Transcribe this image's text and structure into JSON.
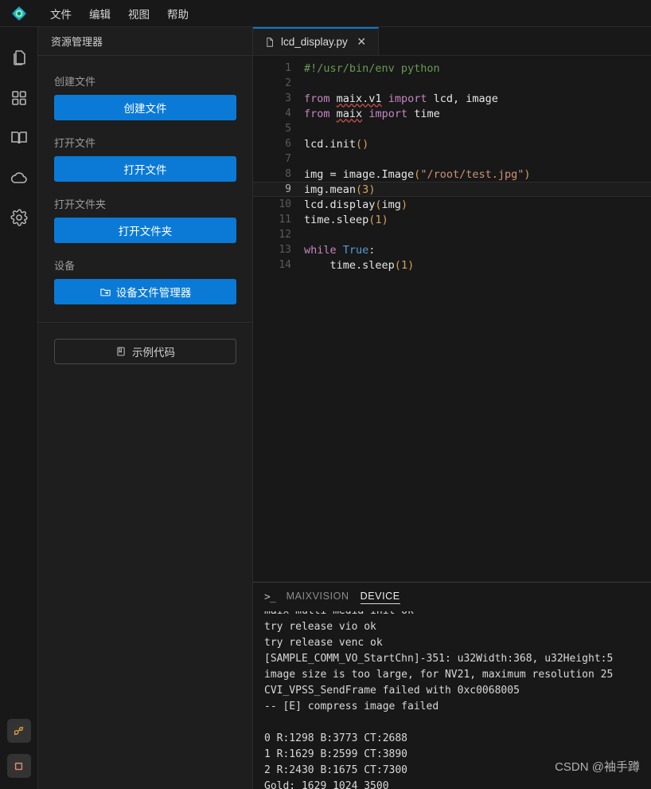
{
  "app": {
    "logo_icon": "maixvision-eye-logo",
    "menu": [
      {
        "label": "文件",
        "name": "menu-file"
      },
      {
        "label": "编辑",
        "name": "menu-edit"
      },
      {
        "label": "视图",
        "name": "menu-view"
      },
      {
        "label": "帮助",
        "name": "menu-help"
      }
    ]
  },
  "activitybar": {
    "items": [
      {
        "icon": "files-icon",
        "name": "activity-explorer"
      },
      {
        "icon": "grid-apps-icon",
        "name": "activity-apps"
      },
      {
        "icon": "book-icon",
        "name": "activity-docs"
      },
      {
        "icon": "cloud-icon",
        "name": "activity-cloud"
      },
      {
        "icon": "gear-icon",
        "name": "activity-settings"
      }
    ],
    "bottom": [
      {
        "icon": "connect-icon",
        "name": "activity-connect-device",
        "color": "#e8a33d"
      },
      {
        "icon": "stop-square-icon",
        "name": "activity-stop-run",
        "color": "#e38a72"
      }
    ]
  },
  "sidebar": {
    "title": "资源管理器",
    "groups": [
      {
        "label": "创建文件",
        "button": "创建文件",
        "icon": null
      },
      {
        "label": "打开文件",
        "button": "打开文件",
        "icon": null
      },
      {
        "label": "打开文件夹",
        "button": "打开文件夹",
        "icon": null
      },
      {
        "label": "设备",
        "button": "设备文件管理器",
        "icon": "device-folder-icon"
      }
    ],
    "example_button": {
      "label": "示例代码",
      "icon": "book-code-icon"
    }
  },
  "editor": {
    "tabs": [
      {
        "label": "lcd_display.py",
        "icon": "file-icon",
        "close_icon": "close-icon",
        "active": true
      }
    ],
    "active_line": 9,
    "lines": [
      {
        "n": 1,
        "tokens": [
          {
            "t": "#!/usr/bin/env python",
            "c": "c-com"
          }
        ]
      },
      {
        "n": 2,
        "tokens": []
      },
      {
        "n": 3,
        "tokens": [
          {
            "t": "from",
            "c": "c-kw"
          },
          {
            "t": " ",
            "c": "c-op"
          },
          {
            "t": "maix.v1",
            "c": "c-id squig"
          },
          {
            "t": " ",
            "c": "c-op"
          },
          {
            "t": "import",
            "c": "c-kw"
          },
          {
            "t": " lcd, image",
            "c": "c-id"
          }
        ]
      },
      {
        "n": 4,
        "tokens": [
          {
            "t": "from",
            "c": "c-kw"
          },
          {
            "t": " ",
            "c": "c-op"
          },
          {
            "t": "maix",
            "c": "c-id squig"
          },
          {
            "t": " ",
            "c": "c-op"
          },
          {
            "t": "import",
            "c": "c-kw"
          },
          {
            "t": " time",
            "c": "c-id"
          }
        ]
      },
      {
        "n": 5,
        "tokens": []
      },
      {
        "n": 6,
        "tokens": [
          {
            "t": "lcd.init",
            "c": "c-id"
          },
          {
            "t": "()",
            "c": "c-pun"
          }
        ]
      },
      {
        "n": 7,
        "tokens": []
      },
      {
        "n": 8,
        "tokens": [
          {
            "t": "img = image.Image",
            "c": "c-id"
          },
          {
            "t": "(",
            "c": "c-pun"
          },
          {
            "t": "\"/root/test.jpg\"",
            "c": "c-str"
          },
          {
            "t": ")",
            "c": "c-pun"
          }
        ]
      },
      {
        "n": 9,
        "tokens": [
          {
            "t": "img.mean",
            "c": "c-id"
          },
          {
            "t": "(",
            "c": "c-pun"
          },
          {
            "t": "3",
            "c": "c-num"
          },
          {
            "t": ")",
            "c": "c-pun"
          }
        ]
      },
      {
        "n": 10,
        "tokens": [
          {
            "t": "lcd.display",
            "c": "c-id"
          },
          {
            "t": "(",
            "c": "c-pun"
          },
          {
            "t": "img",
            "c": "c-id"
          },
          {
            "t": ")",
            "c": "c-pun"
          }
        ]
      },
      {
        "n": 11,
        "tokens": [
          {
            "t": "time.sleep",
            "c": "c-id"
          },
          {
            "t": "(",
            "c": "c-pun"
          },
          {
            "t": "1",
            "c": "c-num"
          },
          {
            "t": ")",
            "c": "c-pun"
          }
        ]
      },
      {
        "n": 12,
        "tokens": []
      },
      {
        "n": 13,
        "tokens": [
          {
            "t": "while",
            "c": "c-kw"
          },
          {
            "t": " ",
            "c": "c-op"
          },
          {
            "t": "True",
            "c": "c-bool"
          },
          {
            "t": ":",
            "c": "c-op"
          }
        ]
      },
      {
        "n": 14,
        "tokens": [
          {
            "t": "    time.sleep",
            "c": "c-id"
          },
          {
            "t": "(",
            "c": "c-pun"
          },
          {
            "t": "1",
            "c": "c-num"
          },
          {
            "t": ")",
            "c": "c-pun"
          }
        ]
      }
    ]
  },
  "panel": {
    "prompt_icon": ">_",
    "tabs": [
      {
        "label": "MAIXVISION",
        "active": false
      },
      {
        "label": "DEVICE",
        "active": true
      }
    ],
    "lines": [
      "maix multi-media init ok",
      "try release vio ok",
      "try release venc ok",
      "[SAMPLE_COMM_VO_StartChn]-351: u32Width:368, u32Height:5",
      "image size is too large, for NV21, maximum resolution 25",
      "CVI_VPSS_SendFrame failed with 0xc0068005",
      "-- [E] compress image failed",
      "",
      "0 R:1298 B:3773 CT:2688",
      "1 R:1629 B:2599 CT:3890",
      "2 R:2430 B:1675 CT:7300",
      "Gold: 1629 1024 3500"
    ]
  },
  "watermark": {
    "text": "CSDN @袖手蹲"
  }
}
